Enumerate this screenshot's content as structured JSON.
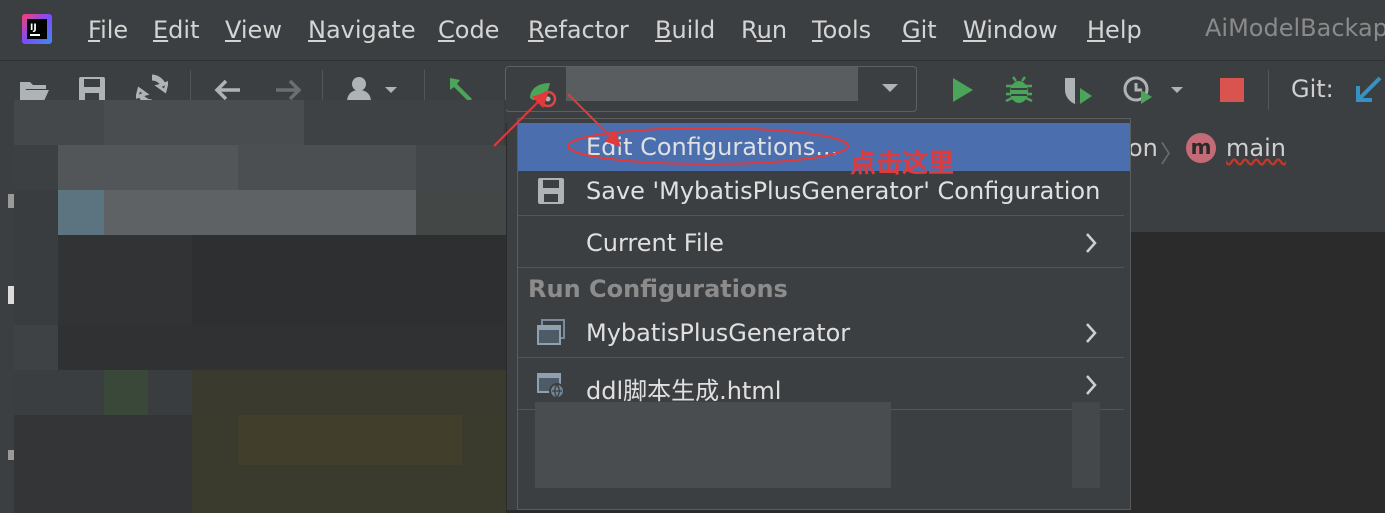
{
  "menubar": {
    "items": [
      {
        "label": "File",
        "mnemonic": "F",
        "rest": "ile"
      },
      {
        "label": "Edit",
        "mnemonic": "E",
        "rest": "dit"
      },
      {
        "label": "View",
        "mnemonic": "V",
        "rest": "iew"
      },
      {
        "label": "Navigate",
        "mnemonic": "N",
        "rest": "avigate"
      },
      {
        "label": "Code",
        "mnemonic": "C",
        "rest": "ode"
      },
      {
        "label": "Refactor",
        "mnemonic": "R",
        "rest": "efactor"
      },
      {
        "label": "Build",
        "mnemonic": "B",
        "rest": "uild"
      },
      {
        "label": "Run",
        "mnemonic": "u",
        "rest_pre": "R",
        "rest": "n"
      },
      {
        "label": "Tools",
        "mnemonic": "T",
        "rest": "ools"
      },
      {
        "label": "Git",
        "mnemonic": "G",
        "rest": "it"
      },
      {
        "label": "Window",
        "mnemonic": "W",
        "rest": "indow"
      },
      {
        "label": "Help",
        "mnemonic": "H",
        "rest": "elp"
      }
    ],
    "project_title": "AiModelBackap"
  },
  "toolbar": {
    "git_label": "Git:",
    "icons": [
      "open-folder-icon",
      "save-icon",
      "sync-icon",
      "back-arrow-icon",
      "forward-arrow-icon",
      "user-dropdown-icon",
      "build-hammer-icon",
      "run-config-icon",
      "run-icon",
      "debug-icon",
      "coverage-icon",
      "profile-icon",
      "stop-icon",
      "git-update-icon"
    ]
  },
  "breadcrumb": {
    "fragment": "on",
    "badge": "m",
    "method": "main"
  },
  "popup": {
    "items": [
      {
        "label": "Edit Configurations...",
        "selected": true
      },
      {
        "label": "Save 'MybatisPlusGenerator' Configuration",
        "icon": "save-icon"
      },
      {
        "label": "Current File",
        "submenu": true
      }
    ],
    "section": "Run Configurations",
    "configs": [
      {
        "label": "MybatisPlusGenerator",
        "icon": "application-config-icon",
        "submenu": true
      },
      {
        "label": "ddl脚本生成.html",
        "icon": "html-config-icon",
        "submenu": true
      }
    ]
  },
  "annotation": {
    "text": "点击这里",
    "color": "#e23a3a"
  },
  "colors": {
    "menubar": "#3c3f41",
    "editor": "#2b2b2b",
    "selection": "#4b6eaf",
    "run_green": "#4aa55a",
    "stop_red": "#d9534f",
    "accent_blue": "#3592c4"
  }
}
